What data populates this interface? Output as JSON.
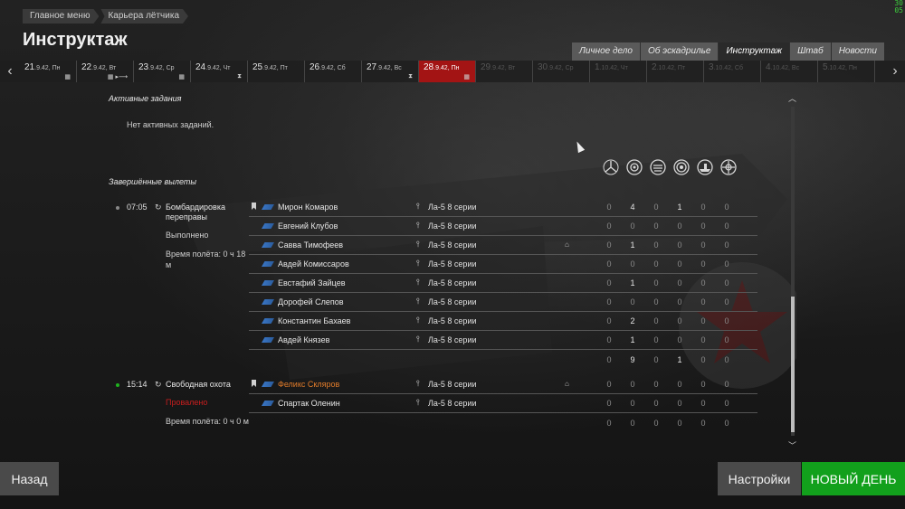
{
  "breadcrumb": [
    "Главное меню",
    "Карьера лётчика"
  ],
  "title": "Инструктаж",
  "fps_counter": [
    "30",
    "05"
  ],
  "tabs": [
    {
      "label": "Личное дело",
      "active": false
    },
    {
      "label": "Об эскадрилье",
      "active": false
    },
    {
      "label": "Инструктаж",
      "active": true
    },
    {
      "label": "Штаб",
      "active": false
    },
    {
      "label": "Новости",
      "active": false
    }
  ],
  "dates": [
    {
      "day": "21",
      "rest": ".9.42, Пн",
      "icon": "▦",
      "state": "past"
    },
    {
      "day": "22",
      "rest": ".9.42, Вт",
      "icon": "▦ ▸⟶",
      "state": "past"
    },
    {
      "day": "23",
      "rest": ".9.42, Ср",
      "icon": "▦",
      "state": "past"
    },
    {
      "day": "24",
      "rest": ".9.42, Чт",
      "icon": "⧗",
      "state": "past"
    },
    {
      "day": "25",
      "rest": ".9.42, Пт",
      "icon": "",
      "state": "past"
    },
    {
      "day": "26",
      "rest": ".9.42, Сб",
      "icon": "",
      "state": "past"
    },
    {
      "day": "27",
      "rest": ".9.42, Вс",
      "icon": "⧗",
      "state": "past"
    },
    {
      "day": "28",
      "rest": ".9.42, Пн",
      "icon": "▦",
      "state": "active"
    },
    {
      "day": "29",
      "rest": ".9.42, Вт",
      "icon": "",
      "state": "future"
    },
    {
      "day": "30",
      "rest": ".9.42, Ср",
      "icon": "",
      "state": "future"
    },
    {
      "day": "1",
      "rest": ".10.42, Чт",
      "icon": "",
      "state": "future"
    },
    {
      "day": "2",
      "rest": ".10.42, Пт",
      "icon": "",
      "state": "future"
    },
    {
      "day": "3",
      "rest": ".10.42, Сб",
      "icon": "",
      "state": "future"
    },
    {
      "day": "4",
      "rest": ".10.42, Вс",
      "icon": "",
      "state": "future"
    },
    {
      "day": "5",
      "rest": ".10.42, Пн",
      "icon": "",
      "state": "future"
    }
  ],
  "active_section": {
    "title": "Активные задания",
    "empty_message": "Нет активных заданий."
  },
  "completed_section": {
    "title": "Завершённые вылеты"
  },
  "stat_icons": [
    "aircraft-kills-icon",
    "ground-kills-icon",
    "vehicle-kills-icon",
    "target-icon",
    "ship-kills-icon",
    "crosshair-icon"
  ],
  "missions": [
    {
      "time": "07:05",
      "name": "Бомбардировка переправы",
      "status": "Выполнено",
      "status_color": "#cfcfcf",
      "flight_time": "Время полёта: 0 ч 18 м",
      "dot_color": "#888888",
      "pilots": [
        {
          "name": "Мирон Комаров",
          "plane": "Ла-5 8 серии",
          "leader": true,
          "player": false,
          "cap": false,
          "stats": [
            0,
            4,
            0,
            1,
            0,
            0
          ]
        },
        {
          "name": "Евгений Клубов",
          "plane": "Ла-5 8 серии",
          "leader": false,
          "player": false,
          "cap": false,
          "stats": [
            0,
            0,
            0,
            0,
            0,
            0
          ]
        },
        {
          "name": "Савва Тимофеев",
          "plane": "Ла-5 8 серии",
          "leader": false,
          "player": false,
          "cap": true,
          "stats": [
            0,
            1,
            0,
            0,
            0,
            0
          ]
        },
        {
          "name": "Авдей Комиссаров",
          "plane": "Ла-5 8 серии",
          "leader": false,
          "player": false,
          "cap": false,
          "stats": [
            0,
            0,
            0,
            0,
            0,
            0
          ]
        },
        {
          "name": "Евстафий Зайцев",
          "plane": "Ла-5 8 серии",
          "leader": false,
          "player": false,
          "cap": false,
          "stats": [
            0,
            1,
            0,
            0,
            0,
            0
          ]
        },
        {
          "name": "Дорофей Слепов",
          "plane": "Ла-5 8 серии",
          "leader": false,
          "player": false,
          "cap": false,
          "stats": [
            0,
            0,
            0,
            0,
            0,
            0
          ]
        },
        {
          "name": "Константин Бахаев",
          "plane": "Ла-5 8 серии",
          "leader": false,
          "player": false,
          "cap": false,
          "stats": [
            0,
            2,
            0,
            0,
            0,
            0
          ]
        },
        {
          "name": "Авдей Князев",
          "plane": "Ла-5 8 серии",
          "leader": false,
          "player": false,
          "cap": false,
          "stats": [
            0,
            1,
            0,
            0,
            0,
            0
          ]
        }
      ],
      "totals": [
        0,
        9,
        0,
        1,
        0,
        0
      ]
    },
    {
      "time": "15:14",
      "name": "Свободная охота",
      "status": "Провалено",
      "status_color": "#c81e1e",
      "flight_time": "Время полёта: 0 ч 0 м",
      "dot_color": "#1fb21f",
      "pilots": [
        {
          "name": "Феликс Скляров",
          "plane": "Ла-5 8 серии",
          "leader": true,
          "player": true,
          "cap": true,
          "stats": [
            0,
            0,
            0,
            0,
            0,
            0
          ]
        },
        {
          "name": "Спартак Оленин",
          "plane": "Ла-5 8 серии",
          "leader": false,
          "player": false,
          "cap": false,
          "stats": [
            0,
            0,
            0,
            0,
            0,
            0
          ]
        }
      ],
      "totals": [
        0,
        0,
        0,
        0,
        0,
        0
      ]
    }
  ],
  "buttons": {
    "back": "Назад",
    "settings": "Настройки",
    "new_day": "НОВЫЙ ДЕНЬ"
  },
  "colors": {
    "accent_red": "#a31414",
    "accent_green": "#12a01c",
    "leader_orange": "#e07b2a"
  }
}
